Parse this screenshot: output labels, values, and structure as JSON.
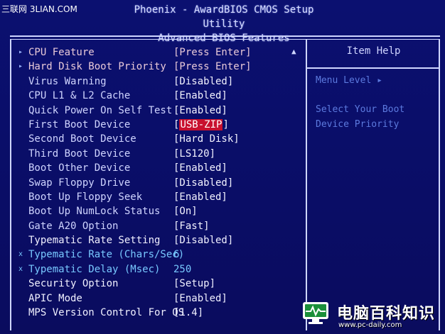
{
  "watermark": "三联网 3LIAN.COM",
  "header": {
    "title": "Phoenix - AwardBIOS CMOS Setup Utility",
    "subtitle": "Advanced BIOS Features"
  },
  "settings": [
    {
      "marker": "▸",
      "label": "CPU Feature",
      "value": "[Press Enter]",
      "style": "submenu"
    },
    {
      "marker": "▸",
      "label": "Hard Disk Boot Priority",
      "value": "[Press Enter]",
      "style": "submenu"
    },
    {
      "marker": "",
      "label": "Virus Warning",
      "value": "[Disabled]",
      "style": "normal"
    },
    {
      "marker": "",
      "label": "CPU L1 & L2 Cache",
      "value": "[Enabled]",
      "style": "normal"
    },
    {
      "marker": "",
      "label": "Quick Power On Self Test",
      "value": "[Enabled]",
      "style": "normal"
    },
    {
      "marker": "",
      "label": "First Boot Device",
      "value": "USB-ZIP",
      "style": "selected"
    },
    {
      "marker": "",
      "label": "Second Boot Device",
      "value": "[Hard Disk]",
      "style": "normal"
    },
    {
      "marker": "",
      "label": "Third Boot Device",
      "value": "[LS120]",
      "style": "normal"
    },
    {
      "marker": "",
      "label": "Boot Other Device",
      "value": "[Enabled]",
      "style": "normal"
    },
    {
      "marker": "",
      "label": "Swap Floppy Drive",
      "value": "[Disabled]",
      "style": "normal"
    },
    {
      "marker": "",
      "label": "Boot Up Floppy Seek",
      "value": "[Enabled]",
      "style": "normal"
    },
    {
      "marker": "",
      "label": "Boot Up NumLock Status",
      "value": "[On]",
      "style": "normal"
    },
    {
      "marker": "",
      "label": "Gate A20 Option",
      "value": "[Fast]",
      "style": "normal"
    },
    {
      "marker": "",
      "label": "Typematic Rate Setting",
      "value": "[Disabled]",
      "style": "light"
    },
    {
      "marker": "x",
      "label": "Typematic Rate (Chars/Sec)",
      "value": "6",
      "style": "dim"
    },
    {
      "marker": "x",
      "label": "Typematic Delay (Msec)",
      "value": "250",
      "style": "dim"
    },
    {
      "marker": "",
      "label": "Security Option",
      "value": "[Setup]",
      "style": "light"
    },
    {
      "marker": "",
      "label": "APIC Mode",
      "value": "[Enabled]",
      "style": "light"
    },
    {
      "marker": "",
      "label": "MPS Version Control For OS",
      "value": "[1.4]",
      "style": "light"
    }
  ],
  "scroll_indicator": "▲",
  "help": {
    "title": "Item Help",
    "menu_level": "Menu Level   ▸",
    "line1": "Select Your Boot",
    "line2": "Device Priority"
  },
  "logo": {
    "name": "电脑百科知识",
    "url": "www.pc-daily.com",
    "icon": "monitor-pulse-icon"
  },
  "colors": {
    "background": "#0a0f6e",
    "selection": "#c8102e",
    "help_text": "#5c7adf"
  }
}
